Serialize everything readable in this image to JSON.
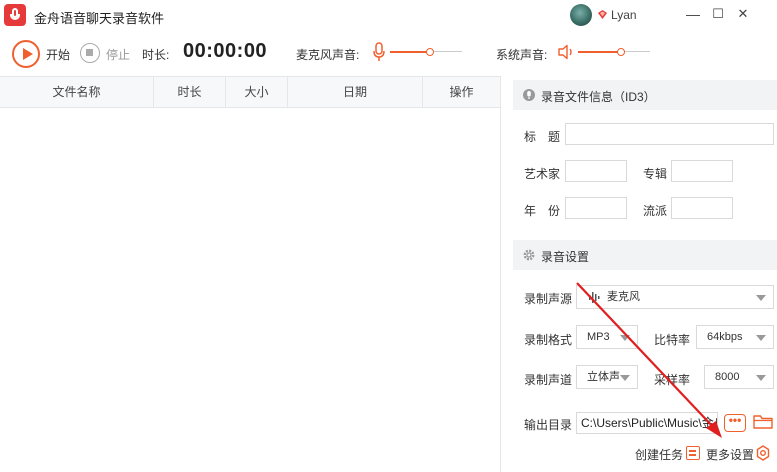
{
  "window": {
    "title": "金舟语音聊天录音软件",
    "user_name": "Lyan",
    "minimize": "—",
    "maximize": "☐",
    "close": "✕"
  },
  "toolbar": {
    "start_label": "开始",
    "stop_label": "停止",
    "duration_label": "时长:",
    "duration_value": "00:00:00",
    "mic_volume_label": "麦克风声音:",
    "mic_volume_level": 0.55,
    "system_volume_label": "系统声音:",
    "system_volume_level": 0.6
  },
  "file_table": {
    "columns": [
      "文件名称",
      "时长",
      "大小",
      "日期",
      "操作"
    ],
    "rows": []
  },
  "id3_section": {
    "title": "录音文件信息（ID3）",
    "title_label": "标　题",
    "title_value": "",
    "artist_label": "艺术家",
    "artist_value": "",
    "album_label": "专辑",
    "album_value": "",
    "year_label": "年　份",
    "year_value": "",
    "genre_label": "流派",
    "genre_value": ""
  },
  "record_settings": {
    "title": "录音设置",
    "source_label": "录制声源",
    "source_value": "麦克风",
    "format_label": "录制格式",
    "format_value": "MP3",
    "bitrate_label": "比特率",
    "bitrate_value": "64kbps",
    "channel_label": "录制声道",
    "channel_value": "立体声",
    "samplerate_label": "采样率",
    "samplerate_value": "8000",
    "output_label": "输出目录",
    "output_value": "C:\\Users\\Public\\Music\\金舟",
    "browse_dots": "•••"
  },
  "footer": {
    "create_task": "创建任务",
    "more_settings": "更多设置"
  },
  "colors": {
    "accent": "#f0602f",
    "annotation": "#e02020",
    "logo": "#e63a3a"
  }
}
